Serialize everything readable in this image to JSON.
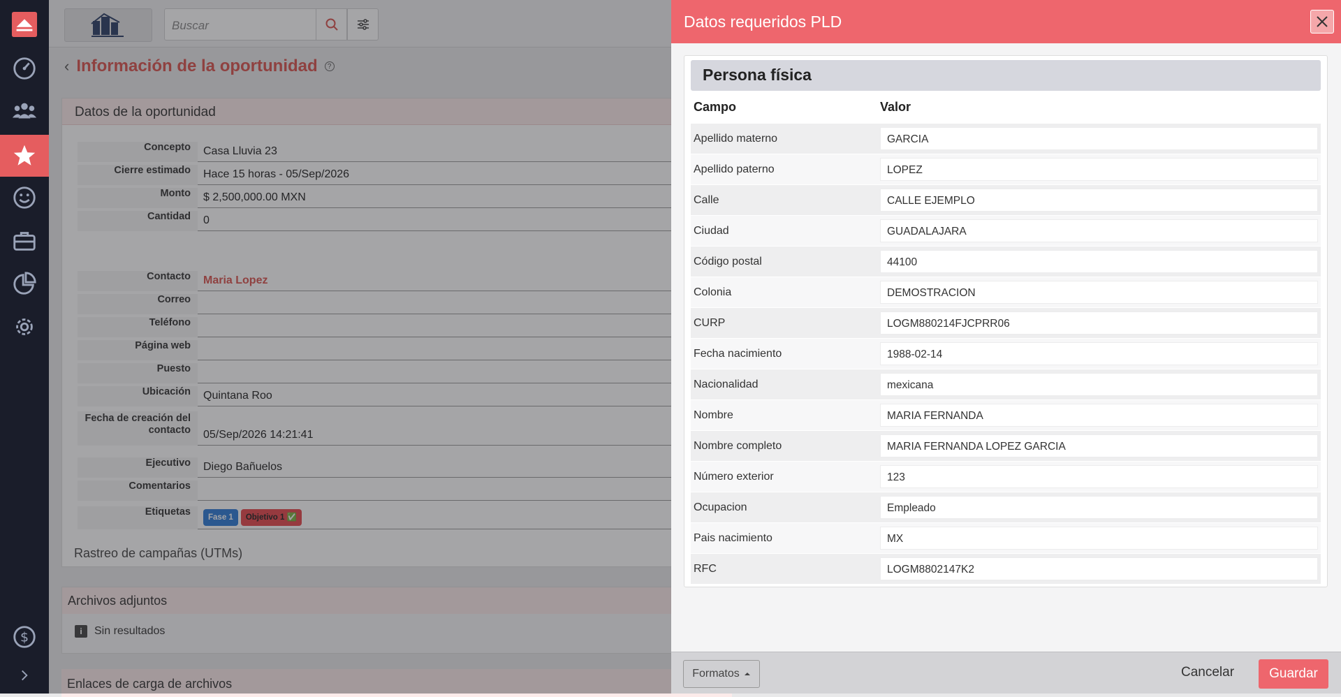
{
  "app": {
    "search_placeholder": "Buscar",
    "page_title": "Información de la oportunidad",
    "help_glyph": "?"
  },
  "sidebar": {
    "items": [
      {
        "icon": "upload-icon"
      },
      {
        "icon": "dashboard-gauge-icon"
      },
      {
        "icon": "users-icon"
      },
      {
        "icon": "star-icon",
        "active": true
      },
      {
        "icon": "smile-icon"
      },
      {
        "icon": "briefcase-icon"
      },
      {
        "icon": "pie-chart-icon"
      },
      {
        "icon": "gear-icon"
      },
      {
        "icon": "dollar-icon"
      },
      {
        "icon": "chevron-right-icon"
      }
    ]
  },
  "opportunity": {
    "card_title": "Datos de la oportunidad",
    "fields": {
      "concepto": {
        "label": "Concepto",
        "value": "Casa Lluvia 23"
      },
      "cierre": {
        "label": "Cierre estimado",
        "value": "Hace 15 horas - 05/Sep/2026"
      },
      "monto": {
        "label": "Monto",
        "value": "$ 2,500,000.00 MXN"
      },
      "cantidad": {
        "label": "Cantidad",
        "value": "0"
      },
      "contacto": {
        "label": "Contacto",
        "value": "Maria Lopez"
      },
      "correo": {
        "label": "Correo",
        "value": ""
      },
      "telefono": {
        "label": "Teléfono",
        "value": ""
      },
      "web": {
        "label": "Página web",
        "value": ""
      },
      "puesto": {
        "label": "Puesto",
        "value": ""
      },
      "ubicacion": {
        "label": "Ubicación",
        "value": "Quintana Roo"
      },
      "fecha_creacion": {
        "label": "Fecha de creación del contacto",
        "value": "05/Sep/2026 14:21:41"
      },
      "ejecutivo": {
        "label": "Ejecutivo",
        "value": "Diego Bañuelos"
      },
      "comentarios": {
        "label": "Comentarios",
        "value": ""
      },
      "etiquetas": {
        "label": "Etiquetas",
        "tags": [
          "Fase 1",
          "Objetivo 1 ✅"
        ]
      }
    },
    "utm_title": "Rastreo de campañas (UTMs)",
    "attachments_title": "Archivos adjuntos",
    "attachments_empty": "Sin resultados",
    "info_glyph": "i",
    "links_title": "Enlaces de carga de archivos"
  },
  "modal": {
    "title": "Datos requeridos PLD",
    "section": "Persona física",
    "col_field": "Campo",
    "col_value": "Valor",
    "rows": [
      {
        "field": "Apellido materno",
        "value": "GARCIA"
      },
      {
        "field": "Apellido paterno",
        "value": "LOPEZ"
      },
      {
        "field": "Calle",
        "value": "CALLE EJEMPLO"
      },
      {
        "field": "Ciudad",
        "value": "GUADALAJARA"
      },
      {
        "field": "Código postal",
        "value": "44100"
      },
      {
        "field": "Colonia",
        "value": "DEMOSTRACION"
      },
      {
        "field": "CURP",
        "value": "LOGM880214FJCPRR06"
      },
      {
        "field": "Fecha nacimiento",
        "value": "1988-02-14"
      },
      {
        "field": "Nacionalidad",
        "value": "mexicana"
      },
      {
        "field": "Nombre",
        "value": "MARIA FERNANDA"
      },
      {
        "field": "Nombre completo",
        "value": "MARIA FERNANDA LOPEZ GARCIA"
      },
      {
        "field": "Número exterior",
        "value": "123"
      },
      {
        "field": "Ocupacion",
        "value": "Empleado"
      },
      {
        "field": "Pais nacimiento",
        "value": "MX"
      },
      {
        "field": "RFC",
        "value": "LOGM8802147K2"
      }
    ],
    "formats_label": "Formatos",
    "cancel_label": "Cancelar",
    "save_label": "Guardar"
  },
  "colors": {
    "accent": "#ee666d",
    "sidebar_bg": "#1a1d2a",
    "title_red": "#d9534f"
  }
}
